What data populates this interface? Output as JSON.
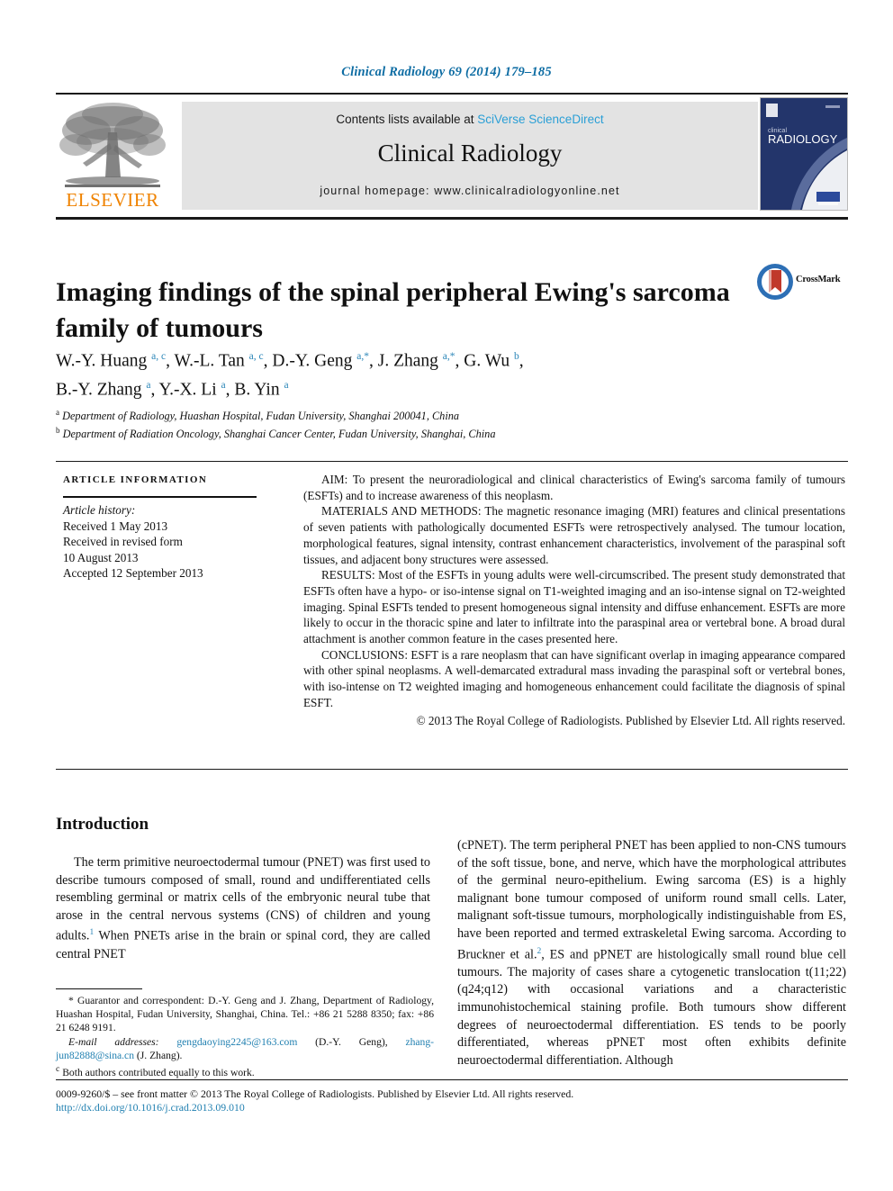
{
  "running_head": "Clinical Radiology 69 (2014) 179–185",
  "masthead": {
    "publisher_wordmark": "ELSEVIER",
    "contents_prefix": "Contents lists available at ",
    "contents_link": "SciVerse ScienceDirect",
    "journal_title": "Clinical Radiology",
    "homepage": "journal homepage: www.clinicalradiologyonline.net",
    "cover_line1": "clinical",
    "cover_line2": "RADIOLOGY"
  },
  "article": {
    "title": "Imaging findings of the spinal peripheral Ewing's sarcoma family of tumours",
    "crossmark_label": "CrossMark",
    "authors_line1": "W.-Y. Huang a, c, W.-L. Tan a, c, D.-Y. Geng a,*, J. Zhang a,*, G. Wu b,",
    "authors_line2": "B.-Y. Zhang a, Y.-X. Li a, B. Yin a",
    "affiliation_a": "Department of Radiology, Huashan Hospital, Fudan University, Shanghai 200041, China",
    "affiliation_b": "Department of Radiation Oncology, Shanghai Cancer Center, Fudan University, Shanghai, China"
  },
  "article_info": {
    "heading": "ARTICLE INFORMATION",
    "history_label": "Article history:",
    "received": "Received 1 May 2013",
    "revised_label": "Received in revised form",
    "revised_date": "10 August 2013",
    "accepted": "Accepted 12 September 2013"
  },
  "abstract": {
    "aim": "AIM: To present the neuroradiological and clinical characteristics of Ewing's sarcoma family of tumours (ESFTs) and to increase awareness of this neoplasm.",
    "methods": "MATERIALS AND METHODS: The magnetic resonance imaging (MRI) features and clinical presentations of seven patients with pathologically documented ESFTs were retrospectively analysed. The tumour location, morphological features, signal intensity, contrast enhancement characteristics, involvement of the paraspinal soft tissues, and adjacent bony structures were assessed.",
    "results": "RESULTS: Most of the ESFTs in young adults were well-circumscribed. The present study demonstrated that ESFTs often have a hypo- or iso-intense signal on T1-weighted imaging and an iso-intense signal on T2-weighted imaging. Spinal ESFTs tended to present homogeneous signal intensity and diffuse enhancement. ESFTs are more likely to occur in the thoracic spine and later to infiltrate into the paraspinal area or vertebral bone. A broad dural attachment is another common feature in the cases presented here.",
    "conclusions": "CONCLUSIONS: ESFT is a rare neoplasm that can have significant overlap in imaging appearance compared with other spinal neoplasms. A well-demarcated extradural mass invading the paraspinal soft or vertebral bones, with iso-intense on T2 weighted imaging and homogeneous enhancement could facilitate the diagnosis of spinal ESFT.",
    "copyright": "© 2013 The Royal College of Radiologists. Published by Elsevier Ltd. All rights reserved."
  },
  "body": {
    "intro_heading": "Introduction",
    "left_paragraph_part1": "The term primitive neuroectodermal tumour (PNET) was first used to describe tumours composed of small, round and undifferentiated cells resembling germinal or matrix cells of the embryonic neural tube that arose in the central nervous systems (CNS) of children and young adults.",
    "left_ref1": "1",
    "left_paragraph_part2": " When PNETs arise in the brain or spinal cord, they are called central PNET",
    "right_paragraph_part1": "(cPNET). The term peripheral PNET has been applied to non-CNS tumours of the soft tissue, bone, and nerve, which have the morphological attributes of the germinal neuro-epithelium. Ewing sarcoma (ES) is a highly malignant bone tumour composed of uniform round small cells. Later, malignant soft-tissue tumours, morphologically indistinguishable from ES, have been reported and termed extraskeletal Ewing sarcoma. According to Bruckner et al.",
    "right_ref2": "2",
    "right_paragraph_part2": ", ES and pPNET are histologically small round blue cell tumours. The majority of cases share a cytogenetic translocation t(11;22)(q24;q12) with occasional variations and a characteristic immunohistochemical staining profile. Both tumours show different degrees of neuroectodermal differentiation. ES tends to be poorly differentiated, whereas pPNET most often exhibits definite neuroectodermal differentiation. Although"
  },
  "footnotes": {
    "correspondent": "* Guarantor and correspondent: D.-Y. Geng and J. Zhang, Department of Radiology, Huashan Hospital, Fudan University, Shanghai, China. Tel.: +86 21 5288 8350; fax: +86 21 6248 9191.",
    "email_label": "E-mail addresses:",
    "email_1": "gengdaoying2245@163.com",
    "email_1_owner": "(D.-Y. Geng),",
    "email_2": "zhang-jun82888@sina.cn",
    "email_2_owner": "(J. Zhang).",
    "equal_contribution_marker": "c",
    "equal_contribution": "Both authors contributed equally to this work."
  },
  "imprint": {
    "line": "0009-9260/$ – see front matter © 2013 The Royal College of Radiologists. Published by Elsevier Ltd. All rights reserved.",
    "doi": "http://dx.doi.org/10.1016/j.crad.2013.09.010"
  },
  "colors": {
    "link_blue": "#1f7fb0",
    "header_blue": "#0d6ca3",
    "sciencedirect_blue": "#2a9fd6",
    "elsevier_orange": "#ef8200",
    "cover_navy": "#23356b",
    "banner_gray": "#e3e3e3"
  }
}
